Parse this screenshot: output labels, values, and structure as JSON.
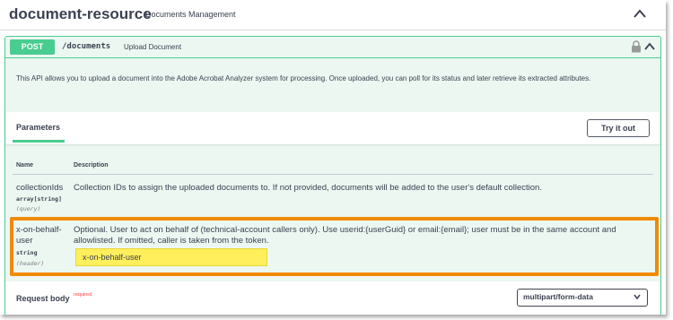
{
  "section": {
    "title": "document-resource",
    "description": "Documents Management"
  },
  "operation": {
    "method": "POST",
    "path": "/documents",
    "summary": "Upload Document",
    "description": "This API allows you to upload a document into the Adobe Acrobat Analyzer system for processing. Once uploaded, you can poll for its status and later retrieve its extracted attributes."
  },
  "parameters": {
    "tab_label": "Parameters",
    "try_button": "Try it out",
    "col_name": "Name",
    "col_description": "Description",
    "items": [
      {
        "name": "collectionIds",
        "type": "array[string]",
        "in": "(query)",
        "description": "Collection IDs to assign the uploaded documents to. If not provided, documents will be added to the user's default collection."
      },
      {
        "name_line1": "x-on-behalf-",
        "name_line2": "user",
        "type": "string",
        "in": "(header)",
        "description": "Optional. User to act on behalf of (technical-account callers only). Use userid:{userGuid} or email:{email}; user must be in the same account and allowlisted. If omitted, caller is taken from the token.",
        "input_value": "x-on-behalf-user"
      }
    ]
  },
  "request_body": {
    "label": "Request body",
    "required": "required",
    "content_type": "multipart/form-data"
  },
  "colors": {
    "post_green": "#49cc90",
    "op_background": "#edf7f2",
    "highlight_orange": "#f08a00",
    "input_yellow": "#ffef5c",
    "required_red": "#f93e3e"
  }
}
